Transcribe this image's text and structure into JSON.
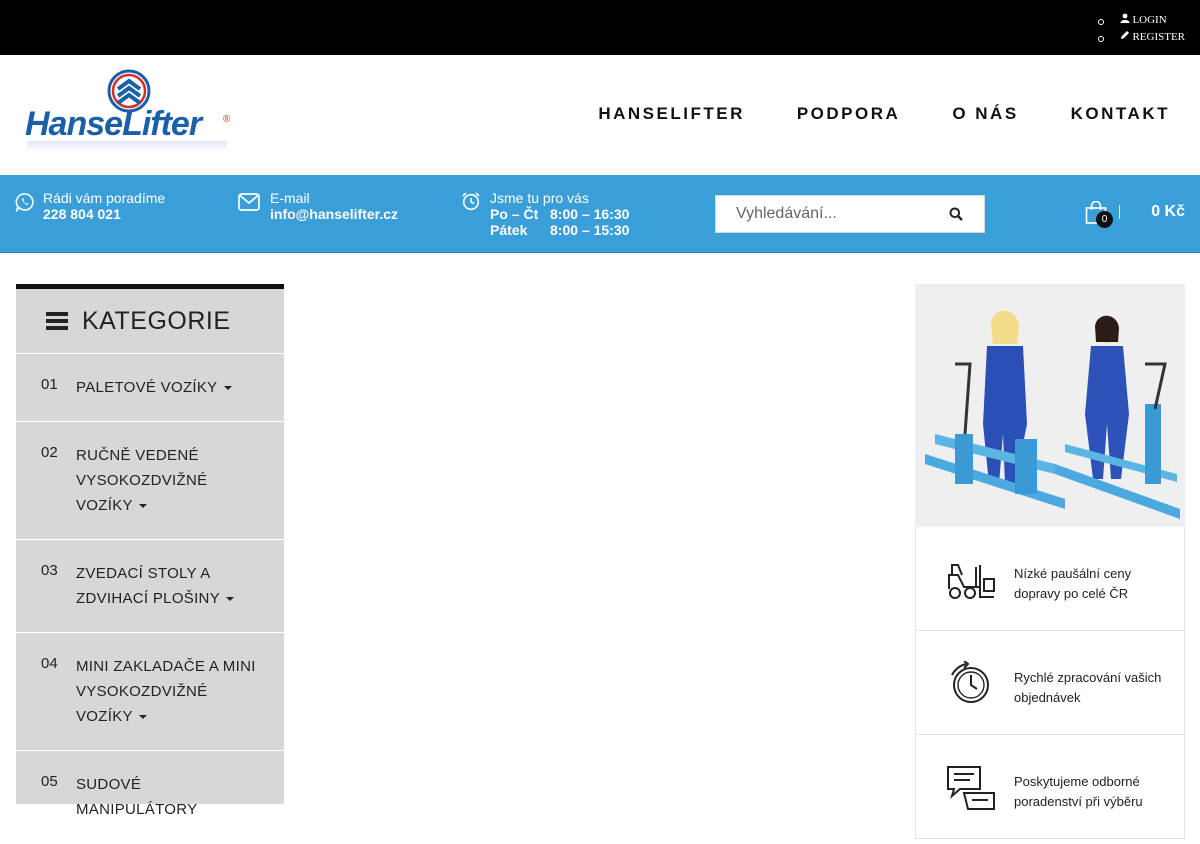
{
  "topbar": {
    "links": [
      {
        "icon": "user-icon",
        "label": "LOGIN"
      },
      {
        "icon": "pencil-icon",
        "label": "REGISTER"
      }
    ]
  },
  "header": {
    "logo_text_1": "Hanse",
    "logo_text_2": "Lifter",
    "logo_reg": "®",
    "nav": [
      "HANSELIFTER",
      "PODPORA",
      "O NÁS",
      "KONTAKT"
    ]
  },
  "infobar": {
    "phone_label": "Rádi vám poradíme",
    "phone": "228 804 021",
    "email_label": "E-mail",
    "email": "info@hanselifter.cz",
    "hours_label": "Jsme tu pro vás",
    "hours": [
      {
        "day": "Po – Čt",
        "time": "8:00 – 16:30"
      },
      {
        "day": "Pátek",
        "time": "8:00 – 15:30"
      }
    ],
    "search_placeholder": "Vyhledávání...",
    "cart_count": "0",
    "cart_total": "0 Kč"
  },
  "sidebar": {
    "title": "KATEGORIE",
    "items": [
      {
        "num": "01",
        "label": "PALETOVÉ VOZÍKY"
      },
      {
        "num": "02",
        "label": "RUČNĚ VEDENÉ VYSOKOZDVIŽNÉ VOZÍKY"
      },
      {
        "num": "03",
        "label": "ZVEDACÍ STOLY A ZDVIHACÍ PLOŠINY"
      },
      {
        "num": "04",
        "label": "MINI ZAKLADAČE A MINI VYSOKOZDVIŽNÉ VOZÍKY"
      },
      {
        "num": "05",
        "label": "SUDOVÉ MANIPULÁTORY"
      }
    ]
  },
  "features": [
    {
      "icon": "forklift-icon",
      "text": "Nízké paušální ceny dopravy po celé ČR"
    },
    {
      "icon": "stopwatch-icon",
      "text": "Rychlé zpracování vašich objednávek"
    },
    {
      "icon": "chat-icon",
      "text": "Poskytujeme odborné poradenství při výběru"
    }
  ],
  "colors": {
    "topbar": "#000000",
    "infobar": "#3a9ed8",
    "sidebar": "#d7d7d7",
    "brand": "#1b5fa8"
  }
}
